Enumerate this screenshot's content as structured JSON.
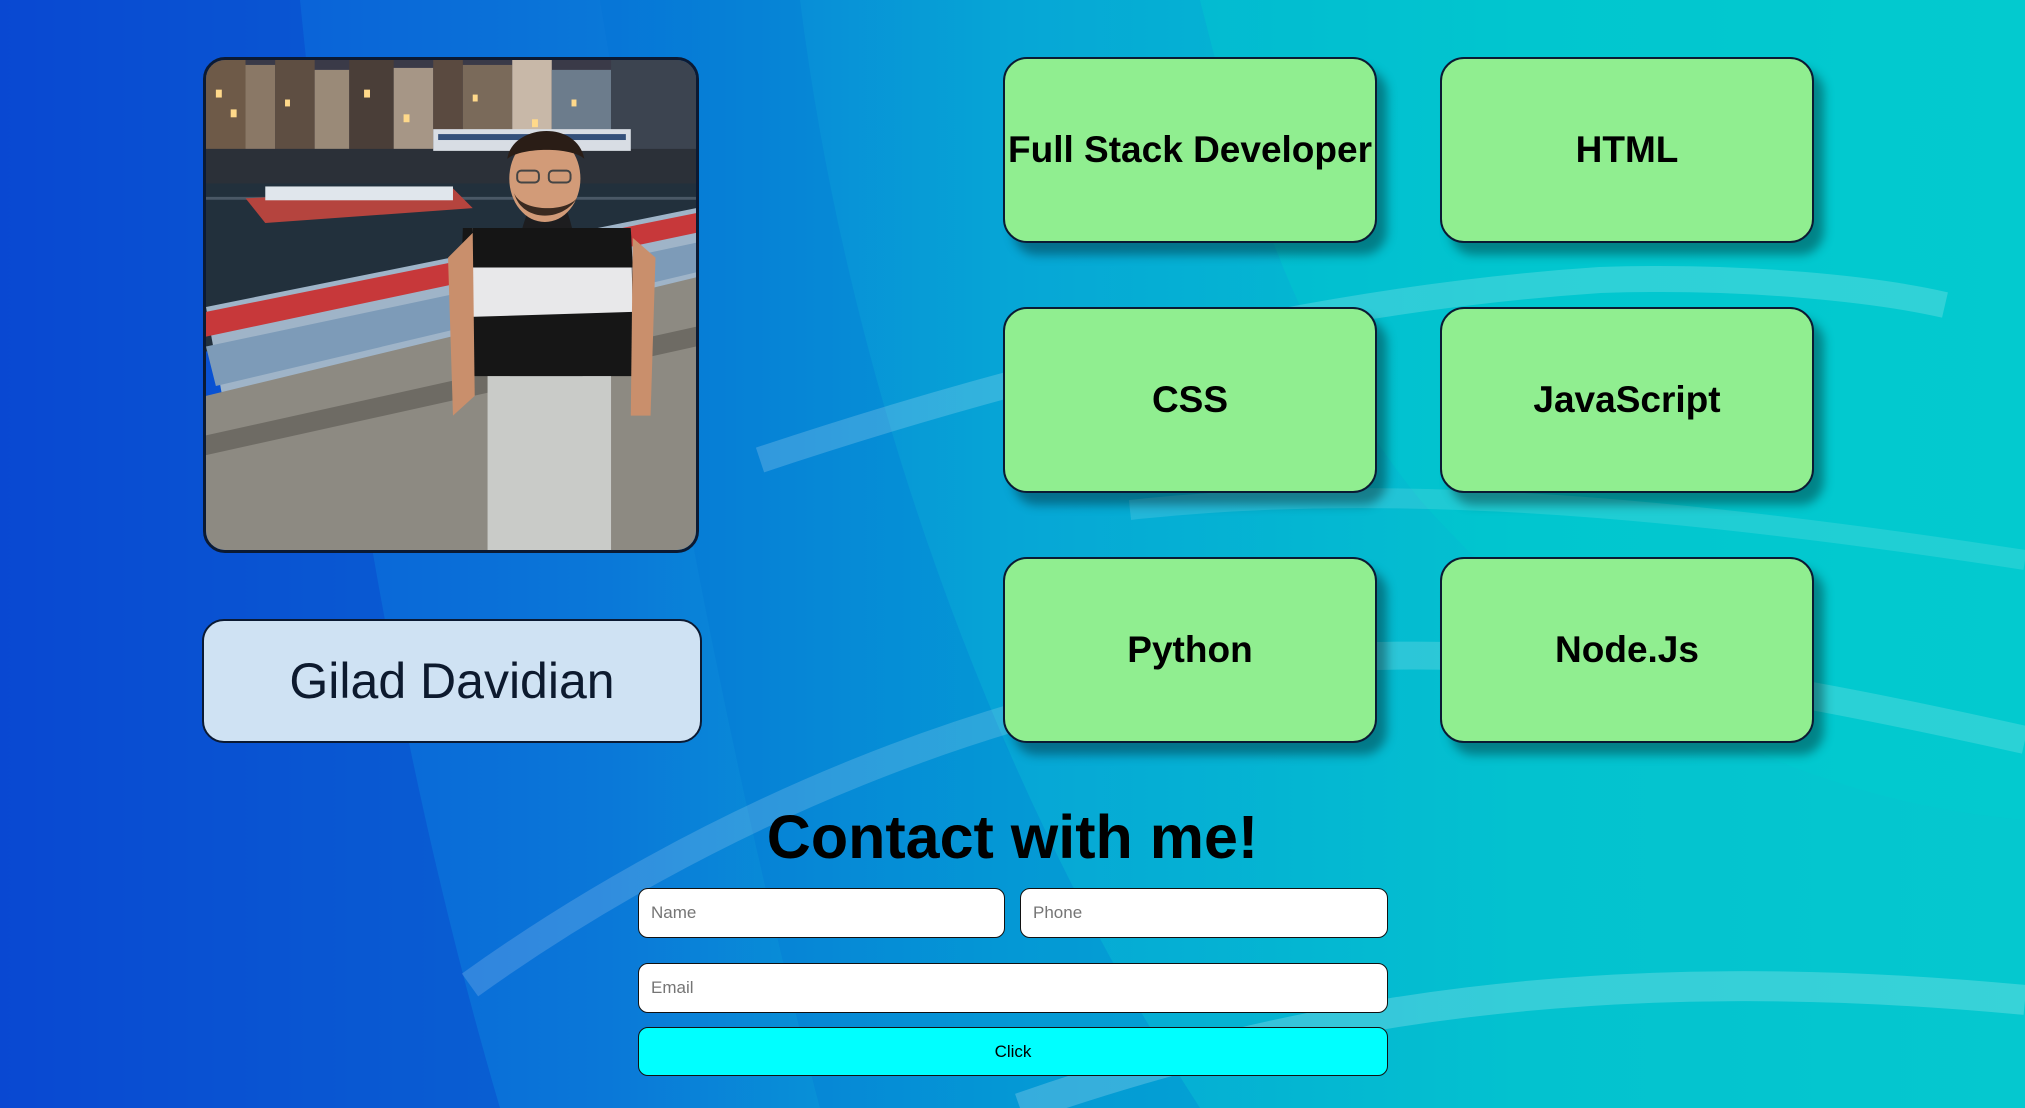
{
  "profile": {
    "name": "Gilad Davidian",
    "photo_icon": "profile-photo"
  },
  "skills": [
    {
      "label": "Full Stack Developer"
    },
    {
      "label": "HTML"
    },
    {
      "label": "CSS"
    },
    {
      "label": "JavaScript"
    },
    {
      "label": "Python"
    },
    {
      "label": "Node.Js"
    }
  ],
  "contact": {
    "title": "Contact with me!",
    "name_placeholder": "Name",
    "phone_placeholder": "Phone",
    "email_placeholder": "Email",
    "submit_label": "Click"
  },
  "colors": {
    "skill_card": "#90ee90",
    "name_card": "#cfe2f3",
    "submit_button": "#00ffff"
  }
}
